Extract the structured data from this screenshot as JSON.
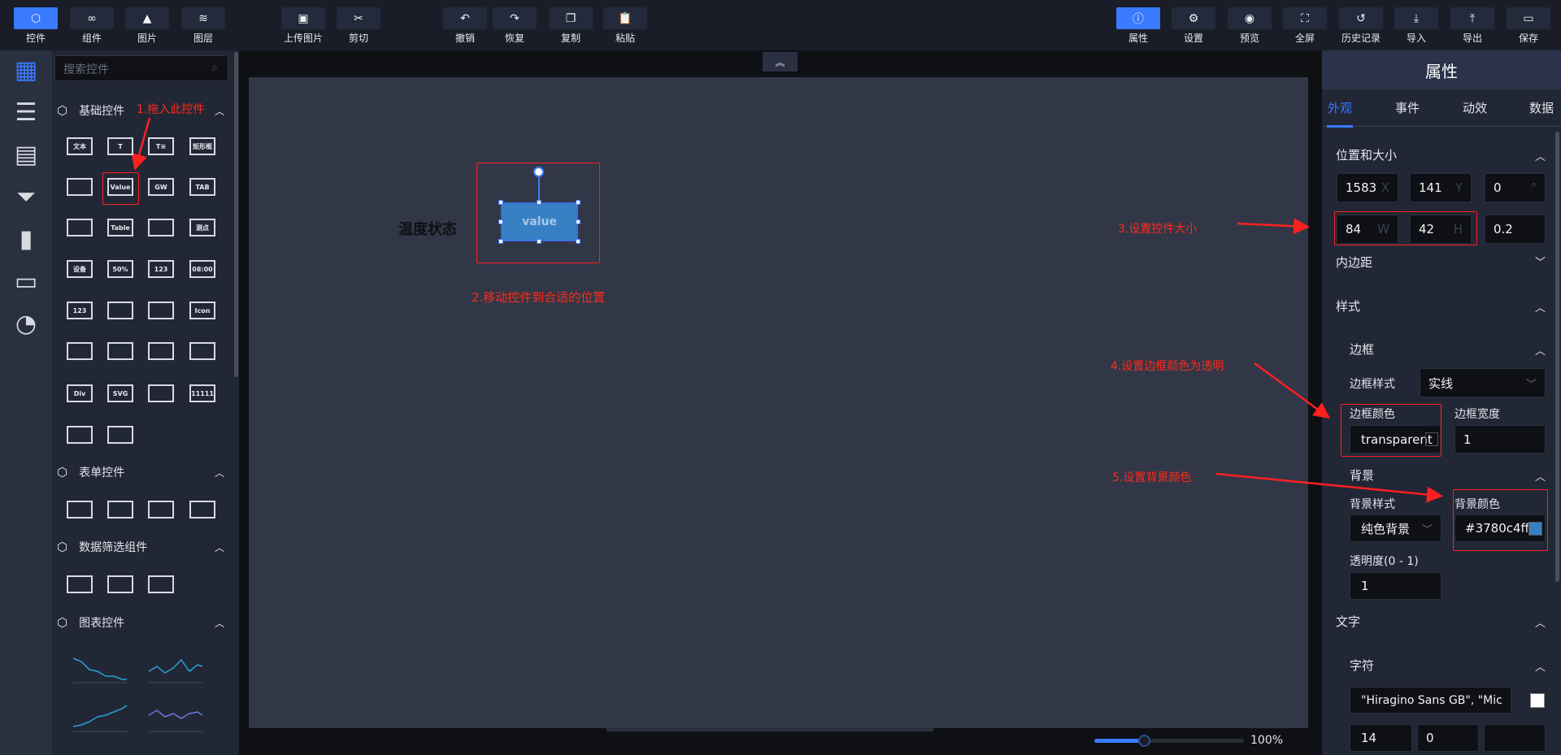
{
  "toolbar": {
    "left": [
      {
        "label": "控件",
        "icon": "cube-icon",
        "active": true
      },
      {
        "label": "组件",
        "icon": "link-icon"
      },
      {
        "label": "图片",
        "icon": "image-icon"
      },
      {
        "label": "图层",
        "icon": "layers-icon"
      },
      {
        "label": "上传图片",
        "icon": "upload-image-icon"
      },
      {
        "label": "剪切",
        "icon": "cut-icon"
      },
      {
        "label": "撤销",
        "icon": "undo-icon"
      },
      {
        "label": "恢复",
        "icon": "redo-icon"
      },
      {
        "label": "复制",
        "icon": "copy-icon"
      },
      {
        "label": "粘贴",
        "icon": "paste-icon"
      }
    ],
    "right": [
      {
        "label": "属性",
        "icon": "info-icon",
        "active": true
      },
      {
        "label": "设置",
        "icon": "gear-icon"
      },
      {
        "label": "预览",
        "icon": "preview-icon"
      },
      {
        "label": "全屏",
        "icon": "fullscreen-icon"
      },
      {
        "label": "历史记录",
        "icon": "history-icon"
      },
      {
        "label": "导入",
        "icon": "import-icon"
      },
      {
        "label": "导出",
        "icon": "export-icon"
      },
      {
        "label": "保存",
        "icon": "save-icon"
      }
    ]
  },
  "components": {
    "search_placeholder": "搜索控件",
    "sections": [
      {
        "title": "基础控件"
      },
      {
        "title": "表单控件"
      },
      {
        "title": "数据筛选组件"
      },
      {
        "title": "图表控件"
      }
    ],
    "basic_widgets": [
      "文本",
      "T",
      "T≡",
      "矩形框",
      "",
      "Value",
      "GW",
      "TAB",
      "",
      "Table",
      "",
      "测点",
      "设备",
      "50%",
      "123",
      "08:00",
      "123",
      "",
      "",
      "Icon",
      "",
      "",
      "",
      "",
      "Div",
      "SVG",
      "",
      "11111",
      "",
      ""
    ]
  },
  "canvas": {
    "label_text": "温度状态",
    "value_widget_text": "value",
    "value_widget_color": "#3780c4",
    "zoom_percent": "100%",
    "zoom_fraction": 0.33
  },
  "annotations": {
    "step1": "1.拖入此控件",
    "step2": "2.移动控件到合适的位置",
    "step3": "3.设置控件大小",
    "step4": "4.设置边框颜色为透明",
    "step5": "5.设置背景颜色"
  },
  "properties": {
    "title": "属性",
    "tabs": [
      "外观",
      "事件",
      "动效",
      "数据"
    ],
    "position_size": {
      "title": "位置和大小",
      "x": "1583",
      "x_unit": "X",
      "y": "141",
      "y_unit": "Y",
      "rotation": "0",
      "rotation_unit": "°",
      "w": "84",
      "w_unit": "W",
      "h": "42",
      "h_unit": "H",
      "extra": "0.2"
    },
    "padding_title": "内边距",
    "style_title": "样式",
    "border": {
      "title": "边框",
      "style_label": "边框样式",
      "style_value": "实线",
      "color_label": "边框颜色",
      "color_value": "transparent",
      "width_label": "边框宽度",
      "width_value": "1"
    },
    "background": {
      "title": "背景",
      "style_label": "背景样式",
      "style_value": "纯色背景",
      "color_label": "背景颜色",
      "color_value": "#3780c4ff",
      "swatch": "#3780c4",
      "opacity_label": "透明度(0 - 1)",
      "opacity_value": "1"
    },
    "text": {
      "title": "文字",
      "char_title": "字符",
      "font_value": "\"Hiragino Sans GB\", \"Mic",
      "font_color": "#ffffff",
      "size": "14",
      "spacing": "0",
      "third": ""
    }
  }
}
